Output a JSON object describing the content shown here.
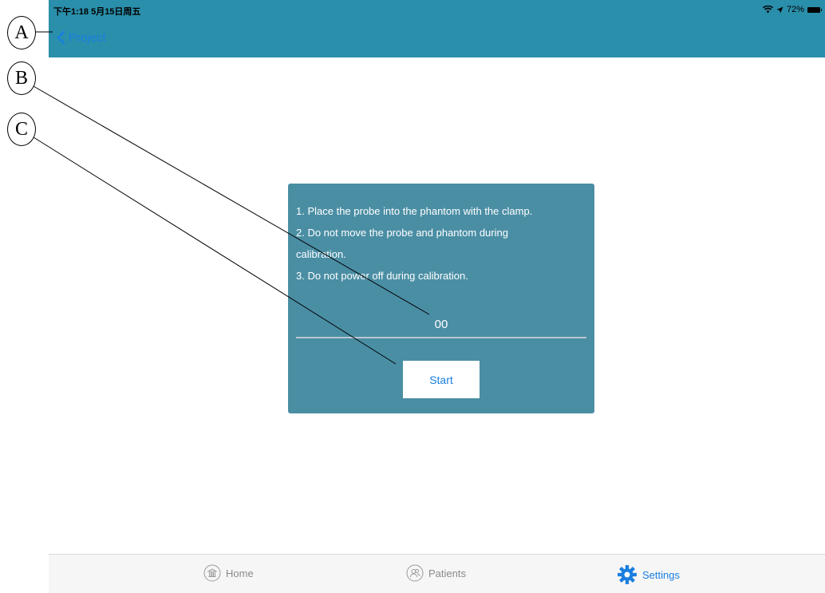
{
  "status_bar": {
    "time": "下午1:18  5月15日周五",
    "battery": "72%"
  },
  "nav": {
    "back_label": "Project"
  },
  "dialog": {
    "instructions": [
      "1. Place the probe into the phantom with the clamp.",
      "2. Do not move the probe and phantom during",
      "calibration.",
      "3. Do not power off during calibration."
    ],
    "counter": "00",
    "start_label": "Start"
  },
  "tabs": [
    {
      "label": "Home",
      "icon": "home-icon",
      "active": false
    },
    {
      "label": "Patients",
      "icon": "patients-icon",
      "active": false
    },
    {
      "label": "Settings",
      "icon": "gear-icon",
      "active": true
    }
  ],
  "callouts": [
    "A",
    "B",
    "C"
  ],
  "colors": {
    "topbar": "#2a8faa",
    "dialog": "#4a8ea4",
    "accent": "#1a7fe0",
    "tabbar": "#f6f6f6"
  }
}
